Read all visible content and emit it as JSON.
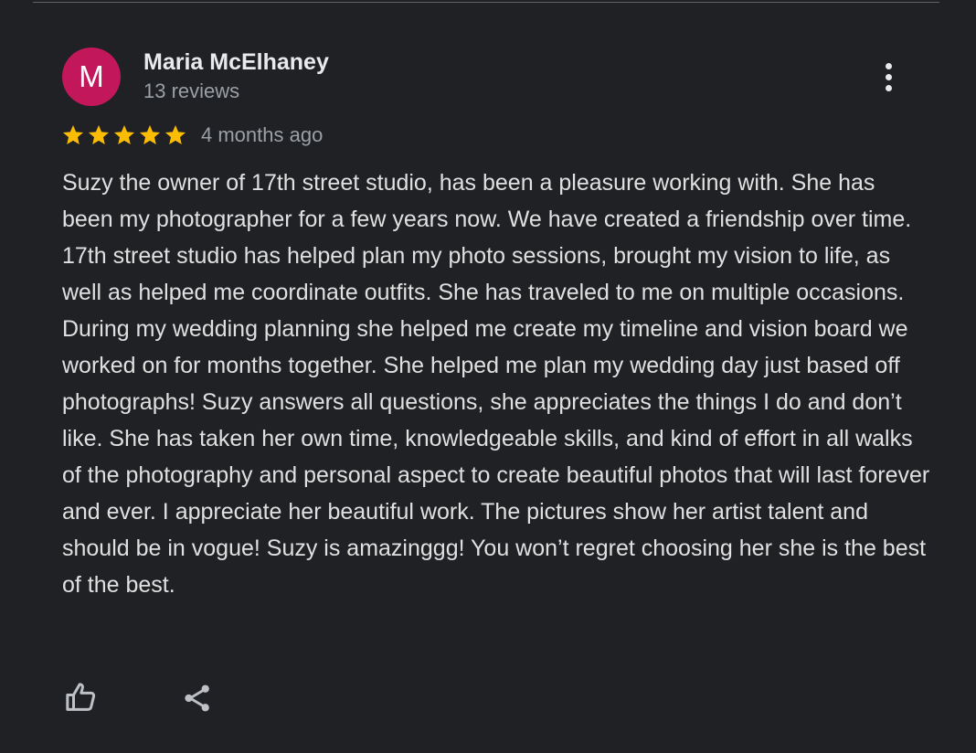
{
  "review": {
    "avatar_initial": "M",
    "author_name": "Maria McElhaney",
    "review_count": "13 reviews",
    "rating": 5,
    "rating_max": 5,
    "date": "4 months ago",
    "text": "Suzy the owner of 17th street studio, has been a pleasure working with. She has been my photographer for a few years now. We have created a friendship over time. 17th street studio has helped plan my photo sessions, brought my vision to life, as well as helped me coordinate outfits. She has traveled to me on multiple occasions. During my wedding planning she helped me create my timeline and vision board we worked on for months together. She helped me plan my wedding day just based off photographs! Suzy answers all questions, she appreciates the things I do and don’t like. She has taken her own time, knowledgeable skills, and kind of effort in all walks of the photography and personal aspect to create beautiful photos that will last forever and ever. I appreciate her beautiful work. The pictures show her artist talent and should be in vogue! Suzy is amazinggg! You won’t regret choosing her she is the best of the best."
  },
  "icons": {
    "menu": "more-vert-icon",
    "star": "star-icon",
    "like": "thumb-up-icon",
    "share": "share-icon"
  },
  "colors": {
    "background": "#202124",
    "avatar": "#c2185b",
    "star": "#fbbc04",
    "name": "#e8eaed",
    "secondary_text": "#9aa0a6",
    "body_text": "#e0e0e0"
  }
}
